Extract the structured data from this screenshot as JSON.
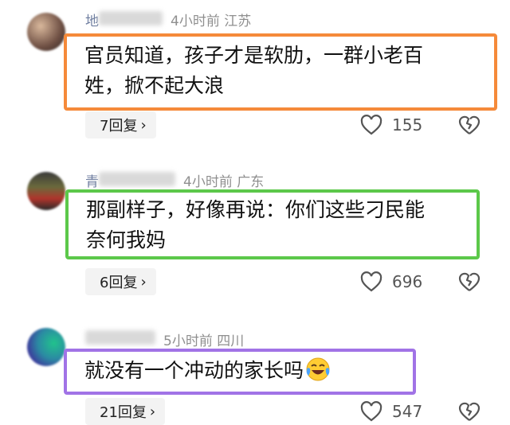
{
  "comments": [
    {
      "time_location": "4小时前 江苏",
      "name_visible": "地",
      "text_line1": "官员知道，孩子才是软肋，一群小老百",
      "text_line2": "姓，掀不起大浪",
      "reply_label": "7回复",
      "likes": "155",
      "border_color": "#f58a3a"
    },
    {
      "time_location": "4小时前 广东",
      "name_visible": "青",
      "text_line1": "那副样子，好像再说：你们这些刁民能",
      "text_line2": "奈何我妈",
      "reply_label": "6回复",
      "likes": "696",
      "border_color": "#5cc84a"
    },
    {
      "time_location": "5小时前 四川",
      "name_visible": "",
      "text_line1": "就没有一个冲动的家长吗",
      "text_line2": "",
      "reply_label": "21回复",
      "likes": "547",
      "border_color": "#a173e6"
    }
  ],
  "icons": {
    "chevron": "chevron-right-icon",
    "like": "heart-icon",
    "dislike": "broken-heart-icon",
    "emoji": "crying-laughing-emoji"
  }
}
